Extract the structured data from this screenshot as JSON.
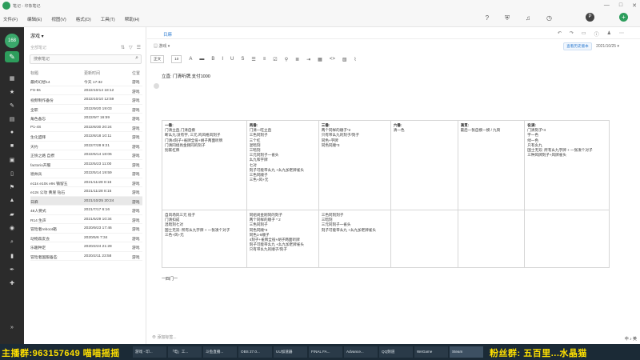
{
  "window": {
    "title": "笔记 - 印象笔记",
    "menu": [
      "文件(F)",
      "编辑(E)",
      "视图(V)",
      "格式(O)",
      "工具(T)",
      "帮助(H)"
    ],
    "avatar_letter": "P",
    "controls": [
      "—",
      "□",
      "✕"
    ]
  },
  "rail": {
    "badge": "168",
    "items": [
      "home",
      "star",
      "note",
      "notebook",
      "tag",
      "work",
      "doc",
      "share",
      "trash",
      "expand"
    ]
  },
  "list": {
    "notebook": "游戏",
    "hint": "全部笔记",
    "search_placeholder": "搜索笔记",
    "headers": [
      "标题",
      "更新时间",
      "位置"
    ],
    "rows": [
      [
        "最终幻想14",
        "今天 17:32",
        "游戏"
      ],
      [
        "FS-8s",
        "2022/10/14 18:12",
        "游戏"
      ],
      [
        "视频制作备份",
        "2022/10/10 12:59",
        "游戏"
      ],
      [
        "全职",
        "2022/9/20 19:03",
        "游戏"
      ],
      [
        "角色备忘",
        "2022/9/7 16:59",
        "游戏"
      ],
      [
        "P1-4S",
        "2022/8/30 20:24",
        "游戏"
      ],
      [
        "生化盟拜",
        "2022/8/18 10:11",
        "游戏"
      ],
      [
        "天约",
        "2022/7/28 9:21",
        "游戏"
      ],
      [
        "正愤之路 自攒",
        "2022/6/14 18:06",
        "游戏"
      ],
      [
        "factorio开服",
        "2022/5/23 11:00",
        "游戏"
      ],
      [
        "德帅兵",
        "2022/5/14 19:59",
        "游戏"
      ],
      [
        "e11s e10s e9s 镇留五",
        "2021/11/28 8:16",
        "游戏"
      ],
      [
        "e12s 公攻 黄崖 钻石",
        "2021/11/28 8:15",
        "游戏"
      ],
      [
        "日麻",
        "2021/10/25 20:24",
        "游戏"
      ],
      [
        "48人要式",
        "2021/7/17 6:16",
        "游戏"
      ],
      [
        "R14 生声",
        "2021/5/29 10:34",
        "游戏"
      ],
      [
        "冒险者reboot箱",
        "2020/9/23 17:46",
        "游戏"
      ],
      [
        "动物森友会",
        "2020/5/6 7:34",
        "游戏"
      ],
      [
        "乐趣种定",
        "2020/2/24 21:28",
        "游戏"
      ],
      [
        "冒险者国服备些",
        "2020/2/11 23:58",
        "游戏"
      ]
    ]
  },
  "editor": {
    "crumb": "日麻",
    "notebook": "游戏",
    "date": "2021/10/25",
    "fix_btn": "查看历史版本",
    "style_select": "正文",
    "size_select": "10",
    "title_line": "立直: 门清听牌,支付1000",
    "table": {
      "row1": [
        [
          "一番:",
          "门清立直,门清自摸",
          "断幺九:没有字, 三元,鸣风格风刻子",
          "门清4刻子+雀牌全役+胡子两面听牌",
          "门清同组尚金刚同的刻子",
          "别家杠牌"
        ],
        [
          "两番:",
          "门清一旺立直",
          "三色同刻子",
          "三个杠",
          "混暗刻",
          "三暗刻",
          "三元同刻子一雀头",
          "幺九和字牌",
          "七对",
          "刻子可能带幺九 +幺九加老牌雀头",
          "三色同顺子",
          "三色+风+元"
        ],
        [
          "三番:",
          "两个同样的顺子*2",
          "只有带幺九的刻子/刻子",
          "同色+字牌",
          "同色同顺*3"
        ],
        [
          "六番:",
          "清一色"
        ],
        [
          "满贯:",
          "最后一张自摸一摸 / 九筒"
        ],
        [
          "役满:",
          "门清刻子*4",
          "字一色",
          "绿一色",
          "只有幺九",
          "国士无双: 所有幺九字牌 + 一张凑个对子",
          "三种风牌刻子+风牌雀头"
        ]
      ],
      "row2": [
        [
          "",
          "自风场风三元 役子",
          "门清扣成",
          "混暗刻七对",
          "国士无双: 所有幺九字牌 + 一张凑个对子",
          "三色+风+元"
        ],
        [
          "",
          "同组尚金刚同的刻子",
          "两个同样的顺子 * 2",
          "三色同刻子",
          "同色同顺*3",
          "同色1-9顺子",
          "4刻子+雀牌全役+胡子两面听牌",
          "刻子可能带幺九 +幺九加老牌雀头",
          "只有带幺九的顺子/刻子"
        ],
        [
          "",
          "三色同刻刻子",
          "三暗刻",
          "三元同刻子一雀头",
          "刻子可能带幺九 +幺九加老牌雀头"
        ],
        [
          ""
        ],
        [
          ""
        ],
        [
          ""
        ]
      ]
    },
    "footer_text": "一四门一",
    "add_tag": "添加标签..."
  },
  "taskbar": {
    "left_overlay": "主播群:963157649 喵喵摇摇",
    "right_overlay": "粉丝群: 五百里...水晶猫",
    "tasks": [
      "游戏 - 印...",
      "「电」工...",
      "斗鱼直播...",
      "OBS 27.0...",
      "UU加速器",
      "FINAL FA...",
      "Advance...",
      "QQ频道",
      "WeGame",
      "Steam"
    ],
    "clock": "中 ♪ 英"
  }
}
